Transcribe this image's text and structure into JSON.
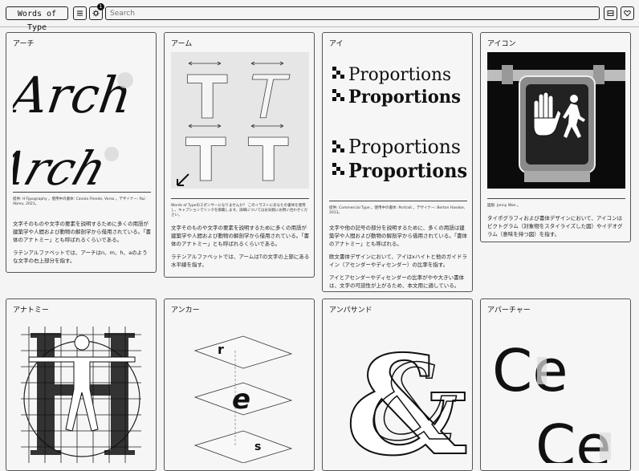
{
  "app": {
    "title": "Words of Type",
    "search_placeholder": "Search"
  },
  "badge_count": "1",
  "icons": {
    "menu": "hamburger-icon",
    "settings": "gear-icon",
    "view": "grid-view-icon",
    "favorite": "heart-icon"
  },
  "cards": [
    {
      "title": "アーチ",
      "art_text": [
        "Arch",
        "Arch"
      ],
      "caption": "提供: H-Typography 。使用中の書体: Canola Ftende, Verso 。デザイナー: Rui Abreu, 2021。",
      "paragraphs": [
        "文字そのものや文字の要素を説明するために多くの用語が建築学や人間および動物の解剖学から借用されている。「書体のアナトミー」とも呼ばれるくらいである。",
        "ラテンアルファベットでは、アーチはn、m、h、aのような文字の右上部分を指す。"
      ]
    },
    {
      "title": "アーム",
      "art_text": [
        "T",
        "T",
        "T",
        "T"
      ],
      "caption": "Words of Typeのスポンサーになりませんか？ このイラストにあなたの書体を使用し、キャプションでリンクを掲載します。詳細についてはお気軽にお問い合わせください。",
      "paragraphs": [
        "文字そのものや文字の要素を説明するために多くの用語が建築学や人間および動物の解剖学から借用されている。「書体のアナトミー」とも呼ばれるくらいである。",
        "ラテンアルファベットでは、アームはTの文字の上部にある水平線を指す。"
      ]
    },
    {
      "title": "アイ",
      "art_text": [
        "Proportions",
        "Proportions",
        "Proportions",
        "Proportions"
      ],
      "caption": "提供: Commercial Type 。使用中の書体: Portrait 。デザイナー: Berton Hasebe, 2013。",
      "paragraphs": [
        "文字や他の記号の部分を説明するために、多くの用語は建築学や人間および動物の解剖学から借用されている。「書体のアナトミー」とも呼ばれる。",
        "欧文書体デザインにおいて、アイはxハイトと他のガイドライン（アセンダーやディセンダー）の比率を指す。",
        "アイとアセンダーやディセンダーの比率がやや大きい書体は、文字の可読性が上がるため、本文用に適している。"
      ]
    },
    {
      "title": "アイコン",
      "caption": "図版: Jonny Wan 。",
      "paragraphs": [
        "タイポグラフィおよび書体デザインにおいて、アイコンはピクトグラム（対象物をスタイライズした図）やイデオグラム（意味を持つ図）を指す。"
      ]
    },
    {
      "title": "アナトミー"
    },
    {
      "title": "アンカー",
      "art_text": [
        "r",
        "e",
        "s"
      ]
    },
    {
      "title": "アンパサンド"
    },
    {
      "title": "アパーチャー",
      "art_text": [
        "Ce",
        "Ce"
      ]
    }
  ]
}
